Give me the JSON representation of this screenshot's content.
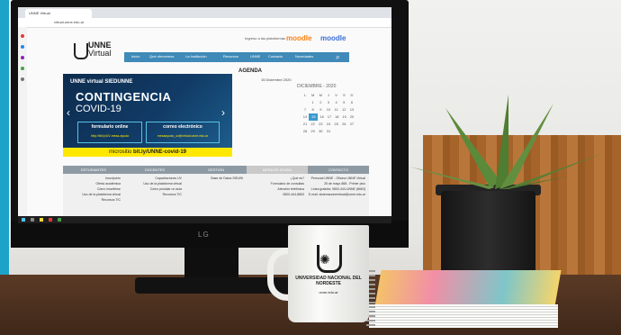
{
  "browser": {
    "tab_title": "UNNE Virtual",
    "url": "virtual.unne.edu.ar"
  },
  "site": {
    "logo_primary": "UNNE",
    "logo_secondary": "Virtual",
    "top_links": "Ingreso a las plataformas",
    "moodle_1": "moodle",
    "moodle_2": "moodle",
    "nav": [
      "Inicio",
      "Qué ofrecemos",
      "La Institución",
      "Recursos",
      "UNNE",
      "Contacto",
      "Novedades"
    ]
  },
  "banner": {
    "brand": "UNNE virtual  SIEDUNNE",
    "title": "CONTINGENCIA",
    "subtitle": "COVID-19",
    "box1_title": "formulario online",
    "box1_link": "http://bit.ly/UV-mesa-ayuda",
    "box2_title": "correo electrónico",
    "box2_link": "mesaayuda_uv@virtual.unne.edu.ar",
    "microsite_label": "micrositio",
    "microsite_link": "bit.ly/UNNE-covid-19"
  },
  "agenda": {
    "title": "AGENDA",
    "date": "15 Diciembre 2020",
    "month": "DICIEMBRE - 2020",
    "weekdays": [
      "L",
      "M",
      "M",
      "J",
      "V",
      "S",
      "D"
    ],
    "weeks": [
      [
        "",
        "1",
        "2",
        "3",
        "4",
        "5",
        "6"
      ],
      [
        "7",
        "8",
        "9",
        "10",
        "11",
        "12",
        "13"
      ],
      [
        "14",
        "15",
        "16",
        "17",
        "18",
        "19",
        "20"
      ],
      [
        "21",
        "22",
        "23",
        "24",
        "25",
        "26",
        "27"
      ],
      [
        "28",
        "29",
        "30",
        "31",
        "",
        "",
        ""
      ]
    ],
    "today": "15"
  },
  "footer": {
    "columns": [
      {
        "head": "ESTUDIANTES",
        "lines": [
          "Inscripción",
          "Oferta académica",
          "Cómo inscribirse",
          "Uso de la plataforma virtual",
          "Recursos TIC"
        ]
      },
      {
        "head": "DOCENTES",
        "lines": [
          "Capacitaciones UV",
          "Uso de la plataforma virtual",
          "Cómo postular un aula",
          "Recursos TIC"
        ]
      },
      {
        "head": "GESTIÓN",
        "lines": [
          "Base de Datos SIEUNI"
        ]
      },
      {
        "head": "MESA DE AYUDA",
        "lines": [
          "¿Qué es?",
          "Formulario de consultas",
          "Atención telefónica",
          "0800-444-8863"
        ]
      },
      {
        "head": "CONTACTO",
        "lines": [
          "Personal UNNE - Oficina UNNE Virtual",
          "25 de mayo 868 - Primer piso",
          "Línea gratuita: 0800-444-UNNE (8663)",
          "E-mail: sistemaunnevirtual@unne.edu.ar"
        ]
      }
    ]
  },
  "monitor_brand": "LG",
  "mug": {
    "university": "UNIVERSIDAD NACIONAL DEL NORDESTE",
    "web": "unne.edu.ar"
  }
}
